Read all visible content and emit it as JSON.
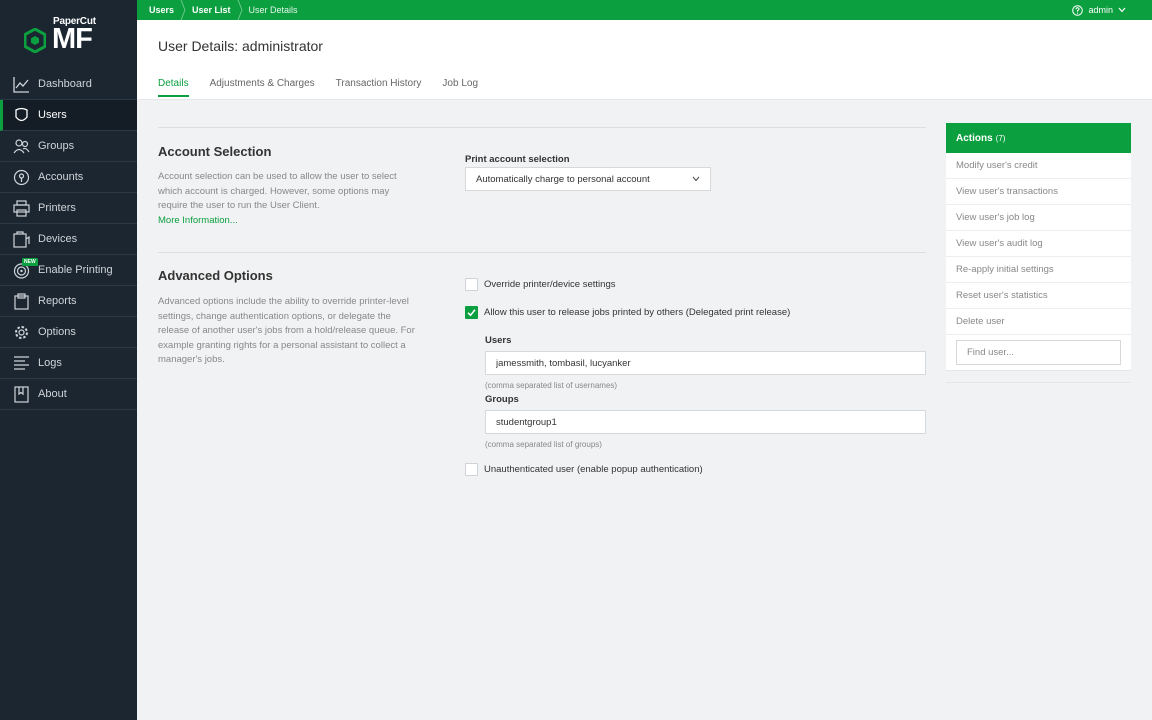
{
  "brand": {
    "small": "PaperCut",
    "big": "MF"
  },
  "sidebar": {
    "items": [
      {
        "label": "Dashboard",
        "icon": "chart-line-icon",
        "active": false
      },
      {
        "label": "Users",
        "icon": "user-icon",
        "active": true
      },
      {
        "label": "Groups",
        "icon": "group-icon",
        "active": false
      },
      {
        "label": "Accounts",
        "icon": "account-icon",
        "active": false
      },
      {
        "label": "Printers",
        "icon": "printer-icon",
        "active": false
      },
      {
        "label": "Devices",
        "icon": "device-icon",
        "active": false
      },
      {
        "label": "Enable Printing",
        "icon": "target-icon",
        "active": false,
        "badge": "NEW"
      },
      {
        "label": "Reports",
        "icon": "clipboard-icon",
        "active": false
      },
      {
        "label": "Options",
        "icon": "gear-icon",
        "active": false
      },
      {
        "label": "Logs",
        "icon": "list-icon",
        "active": false
      },
      {
        "label": "About",
        "icon": "book-icon",
        "active": false
      }
    ]
  },
  "topbar": {
    "breadcrumbs": [
      "Users",
      "User List",
      "User Details"
    ],
    "user": "admin",
    "help_icon": "help-circle-icon"
  },
  "header": {
    "title": "User Details: administrator",
    "tabs": [
      {
        "label": "Details",
        "active": true
      },
      {
        "label": "Adjustments & Charges",
        "active": false
      },
      {
        "label": "Transaction History",
        "active": false
      },
      {
        "label": "Job Log",
        "active": false
      }
    ]
  },
  "account_selection": {
    "title": "Account Selection",
    "desc_lines": [
      "Account selection can be used to allow the user to select",
      "which account is charged. However, some options may",
      "require the user to run the User Client."
    ],
    "more_info": "More Information...",
    "field_label": "Print account selection",
    "selected": "Automatically charge to personal account"
  },
  "advanced_options": {
    "title": "Advanced Options",
    "desc_lines": [
      "Advanced options include the ability to override printer-level",
      "settings, change authentication options, or delegate the",
      "release of another user's jobs from a hold/release queue. For",
      "example granting rights for a personal assistant to collect a",
      "manager's jobs."
    ],
    "override_label": "Override printer/device settings",
    "override_checked": false,
    "delegate_label": "Allow this user to release jobs printed by others (Delegated print release)",
    "delegate_checked": true,
    "users_label": "Users",
    "users_value": "jamessmith, tombasil, lucyanker",
    "users_hint": "(comma separated list of usernames)",
    "groups_label": "Groups",
    "groups_value": "studentgroup1",
    "groups_hint": "(comma separated list of groups)",
    "unauth_label": "Unauthenticated user (enable popup authentication)",
    "unauth_checked": false
  },
  "actions": {
    "title": "Actions",
    "count": "(7)",
    "items": [
      "Modify user's credit",
      "View user's transactions",
      "View user's job log",
      "View user's audit log",
      "Re-apply initial settings",
      "Reset user's statistics",
      "Delete user"
    ],
    "find_placeholder": "Find user..."
  },
  "colors": {
    "accent": "#0b9f3f",
    "sidebar": "#1b2631"
  }
}
